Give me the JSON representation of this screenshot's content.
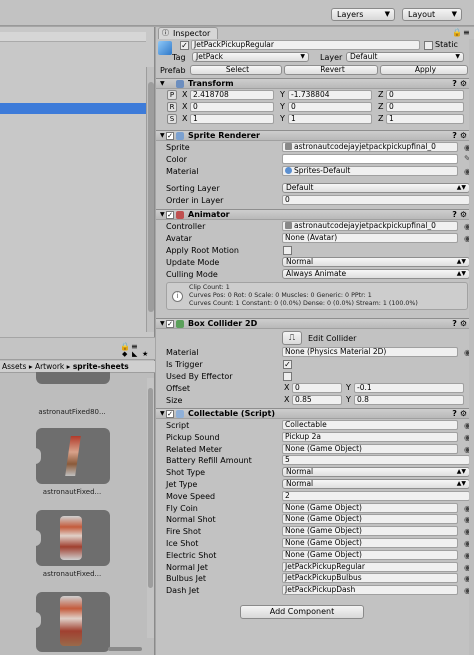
{
  "toolbar": {
    "layers_label": "Layers",
    "layout_label": "Layout"
  },
  "project": {
    "breadcrumb": [
      "Assets",
      "Artwork",
      "sprite-sheets"
    ],
    "items": [
      {
        "label": "astronautFixed80..."
      },
      {
        "label": "astronautFixed..."
      },
      {
        "label": "astronautFixed..."
      },
      {
        "label": ""
      }
    ]
  },
  "inspector": {
    "tab": "Inspector",
    "object_name": "JetPackPickupRegular",
    "static_label": "Static",
    "tag_label": "Tag",
    "tag_value": "JetPack",
    "layer_label": "Layer",
    "layer_value": "Default",
    "prefab_label": "Prefab",
    "prefab_buttons": [
      "Select",
      "Revert",
      "Apply"
    ],
    "transform": {
      "title": "Transform",
      "rows": [
        {
          "btn": "P",
          "x": "2.418708",
          "y": "-1.738804",
          "z": "0"
        },
        {
          "btn": "R",
          "x": "0",
          "y": "0",
          "z": "0"
        },
        {
          "btn": "S",
          "x": "1",
          "y": "1",
          "z": "1"
        }
      ]
    },
    "sprite_renderer": {
      "title": "Sprite Renderer",
      "sprite_label": "Sprite",
      "sprite_value": "astronautcodejayjetpackpickupfinal_0",
      "color_label": "Color",
      "material_label": "Material",
      "material_value": "Sprites-Default",
      "sorting_layer_label": "Sorting Layer",
      "sorting_layer_value": "Default",
      "order_label": "Order in Layer",
      "order_value": "0"
    },
    "animator": {
      "title": "Animator",
      "controller_label": "Controller",
      "controller_value": "astronautcodejayjetpackpickupfinal_0",
      "avatar_label": "Avatar",
      "avatar_value": "None (Avatar)",
      "root_motion_label": "Apply Root Motion",
      "update_mode_label": "Update Mode",
      "update_mode_value": "Normal",
      "culling_label": "Culling Mode",
      "culling_value": "Always Animate",
      "info": [
        "Clip Count: 1",
        "Curves Pos: 0 Rot: 0 Scale: 0 Muscles: 0 Generic: 0 PPtr: 1",
        "Curves Count: 1 Constant: 0 (0.0%) Dense: 0 (0.0%) Stream: 1 (100.0%)"
      ]
    },
    "box_collider": {
      "title": "Box Collider 2D",
      "edit_collider": "Edit Collider",
      "material_label": "Material",
      "material_value": "None (Physics Material 2D)",
      "trigger_label": "Is Trigger",
      "effector_label": "Used By Effector",
      "offset_label": "Offset",
      "offset_x": "0",
      "offset_y": "-0.1",
      "size_label": "Size",
      "size_x": "0.85",
      "size_y": "0.8"
    },
    "collectable": {
      "title": "Collectable (Script)",
      "rows": [
        {
          "label": "Script",
          "value": "Collectable",
          "type": "obj"
        },
        {
          "label": "Pickup Sound",
          "value": "Pickup 2a",
          "type": "obj"
        },
        {
          "label": "Related Meter",
          "value": "None (Game Object)",
          "type": "obj"
        },
        {
          "label": "Battery Refill Amount",
          "value": "5",
          "type": "num"
        },
        {
          "label": "Shot Type",
          "value": "Normal",
          "type": "dd"
        },
        {
          "label": "Jet Type",
          "value": "Normal",
          "type": "dd"
        },
        {
          "label": "Move Speed",
          "value": "2",
          "type": "num"
        },
        {
          "label": "Fly Coin",
          "value": "None (Game Object)",
          "type": "obj"
        },
        {
          "label": "Normal Shot",
          "value": "None (Game Object)",
          "type": "obj"
        },
        {
          "label": "Fire Shot",
          "value": "None (Game Object)",
          "type": "obj"
        },
        {
          "label": "Ice Shot",
          "value": "None (Game Object)",
          "type": "obj"
        },
        {
          "label": "Electric Shot",
          "value": "None (Game Object)",
          "type": "obj"
        },
        {
          "label": "Normal Jet",
          "value": "JetPackPickupRegular",
          "type": "obj"
        },
        {
          "label": "Bulbus Jet",
          "value": "JetPackPickupBulbus",
          "type": "obj"
        },
        {
          "label": "Dash Jet",
          "value": "JetPackPickupDash",
          "type": "obj"
        }
      ]
    },
    "add_component": "Add Component"
  }
}
